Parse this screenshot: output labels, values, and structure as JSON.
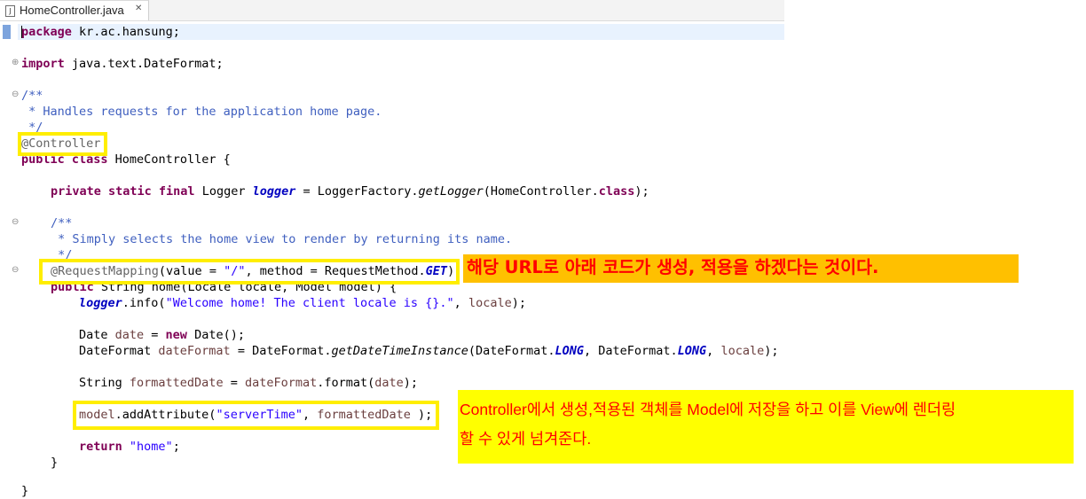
{
  "tab": {
    "filename": "HomeController.java",
    "close_glyph": "✕",
    "icon": "java-file-icon"
  },
  "code": {
    "l1_kw": "package",
    "l1_rest": " kr.ac.hansung;",
    "l2_kw": "import",
    "l2_rest": " java.text.DateFormat;",
    "l3": "/**",
    "l4": " * Handles requests for the application home page.",
    "l5": " */",
    "l6": "@Controller",
    "l7_kw": "public class",
    "l7_rest": " HomeController {",
    "l8_kw": "private static final",
    "l8_a": " Logger ",
    "l8_field": "logger",
    "l8_b": " = LoggerFactory.",
    "l8_method": "getLogger",
    "l8_c": "(HomeController.",
    "l8_kw2": "class",
    "l8_d": ");",
    "l9": "/**",
    "l10": " * Simply selects the home view to render by returning its name.",
    "l11": " */",
    "l12_ann": "@RequestMapping",
    "l12_a": "(value = ",
    "l12_str": "\"/\"",
    "l12_b": ", method = RequestMethod.",
    "l12_field": "GET",
    "l12_c": ")",
    "l13_kw": "public",
    "l13_rest": " String home(Locale locale, Model model) {",
    "l14_field": "logger",
    "l14_a": ".info(",
    "l14_str": "\"Welcome home! The client locale is {}.\"",
    "l14_b": ", ",
    "l14_var": "locale",
    "l14_c": ");",
    "l15_a": "Date ",
    "l15_var": "date",
    "l15_b": " = ",
    "l15_kw": "new",
    "l15_c": " Date();",
    "l16_a": "DateFormat ",
    "l16_var": "dateFormat",
    "l16_b": " = DateFormat.",
    "l16_method": "getDateTimeInstance",
    "l16_c": "(DateFormat.",
    "l16_f1": "LONG",
    "l16_d": ", DateFormat.",
    "l16_f2": "LONG",
    "l16_e": ", ",
    "l16_var2": "locale",
    "l16_f": ");",
    "l17_a": "String ",
    "l17_var": "formattedDate",
    "l17_b": " = ",
    "l17_var2": "dateFormat",
    "l17_c": ".format(",
    "l17_var3": "date",
    "l17_d": ");",
    "l18_var": "model",
    "l18_a": ".addAttribute(",
    "l18_str": "\"serverTime\"",
    "l18_b": ", ",
    "l18_var2": "formattedDate",
    "l18_c": " );",
    "l19_kw": "return",
    "l19_a": " ",
    "l19_str": "\"home\"",
    "l19_b": ";",
    "l20": "}",
    "l21": "}"
  },
  "fold_markers": {
    "expand": "⊕",
    "collapse": "⊖"
  },
  "callouts": {
    "mapping_note": "해당 URL로 아래 코드가 생성, 적용을 하겠다는 것이다.",
    "model_note_line1": "Controller에서 생성,적용된 객체를 Model에 저장을 하고 이를 View에 렌더링",
    "model_note_line2": "할 수 있게 넘겨준다."
  },
  "colors": {
    "keyword": "#7f0055",
    "comment": "#3f5fbf",
    "string": "#2a00ff",
    "annotation": "#646464",
    "field": "#0000c0",
    "local_var": "#6a3e3e",
    "highlight_border": "#ffee00",
    "callout1_bg": "#ffc000",
    "callout2_bg": "#ffff00",
    "callout_text": "#ff0000"
  }
}
